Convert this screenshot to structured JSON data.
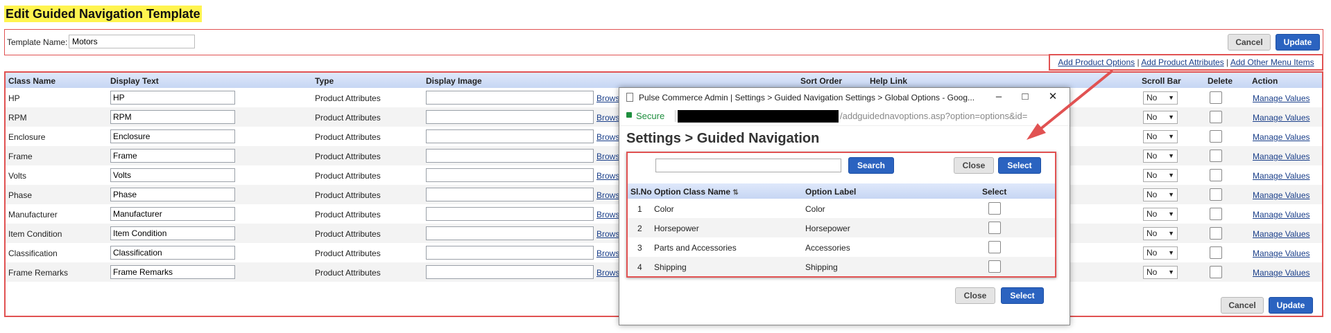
{
  "page": {
    "title": "Edit Guided Navigation Template"
  },
  "template_form": {
    "name_label": "Template Name:",
    "name_value": "Motors",
    "cancel_label": "Cancel",
    "update_label": "Update"
  },
  "links": {
    "add_product_options": "Add Product Options",
    "add_product_attributes": "Add Product Attributes",
    "add_other_menu_items": "Add Other Menu Items",
    "separator": "|"
  },
  "table": {
    "columns": {
      "class_name": "Class Name",
      "display_text": "Display Text",
      "type": "Type",
      "display_image": "Display Image",
      "sort_order": "Sort Order",
      "help_link": "Help Link",
      "scroll_bar": "Scroll Bar",
      "delete": "Delete",
      "action": "Action"
    },
    "browse_label": "Browse",
    "manage_label": "Manage Values",
    "rows": [
      {
        "class_name": "HP",
        "display_text": "HP",
        "type": "Product Attributes",
        "scroll_bar": "No"
      },
      {
        "class_name": "RPM",
        "display_text": "RPM",
        "type": "Product Attributes",
        "scroll_bar": "No"
      },
      {
        "class_name": "Enclosure",
        "display_text": "Enclosure",
        "type": "Product Attributes",
        "scroll_bar": "No"
      },
      {
        "class_name": "Frame",
        "display_text": "Frame",
        "type": "Product Attributes",
        "scroll_bar": "No"
      },
      {
        "class_name": "Volts",
        "display_text": "Volts",
        "type": "Product Attributes",
        "scroll_bar": "No"
      },
      {
        "class_name": "Phase",
        "display_text": "Phase",
        "type": "Product Attributes",
        "scroll_bar": "No"
      },
      {
        "class_name": "Manufacturer",
        "display_text": "Manufacturer",
        "type": "Product Attributes",
        "scroll_bar": "No"
      },
      {
        "class_name": "Item Condition",
        "display_text": "Item Condition",
        "type": "Product Attributes",
        "scroll_bar": "No"
      },
      {
        "class_name": "Classification",
        "display_text": "Classification",
        "type": "Product Attributes",
        "scroll_bar": "No"
      },
      {
        "class_name": "Frame Remarks",
        "display_text": "Frame Remarks",
        "type": "Product Attributes",
        "scroll_bar": "No"
      }
    ],
    "cancel_label": "Cancel",
    "update_label": "Update"
  },
  "popup": {
    "window_title": "Pulse Commerce Admin | Settings > Guided Navigation Settings > Global Options - Goog...",
    "secure_label": "Secure",
    "url_fragment": "/addguidednavoptions.asp?option=options&id=",
    "heading": "Settings > Guided Navigation",
    "search_button": "Search",
    "close_label": "Close",
    "select_label": "Select",
    "columns": {
      "sl_no": "Sl.No",
      "option_class_name": "Option Class Name",
      "option_label": "Option Label",
      "select": "Select"
    },
    "rows": [
      {
        "sl_no": "1",
        "option_class_name": "Color",
        "option_label": "Color"
      },
      {
        "sl_no": "2",
        "option_class_name": "Horsepower",
        "option_label": "Horsepower"
      },
      {
        "sl_no": "3",
        "option_class_name": "Parts and Accessories",
        "option_label": "Accessories"
      },
      {
        "sl_no": "4",
        "option_class_name": "Shipping",
        "option_label": "Shipping"
      }
    ],
    "footer_close": "Close",
    "footer_select": "Select"
  },
  "colors": {
    "highlight": "#fff44f",
    "annotation_red": "#e15252",
    "primary_button": "#2b63c0",
    "header_blue": "#c6d6f3"
  }
}
